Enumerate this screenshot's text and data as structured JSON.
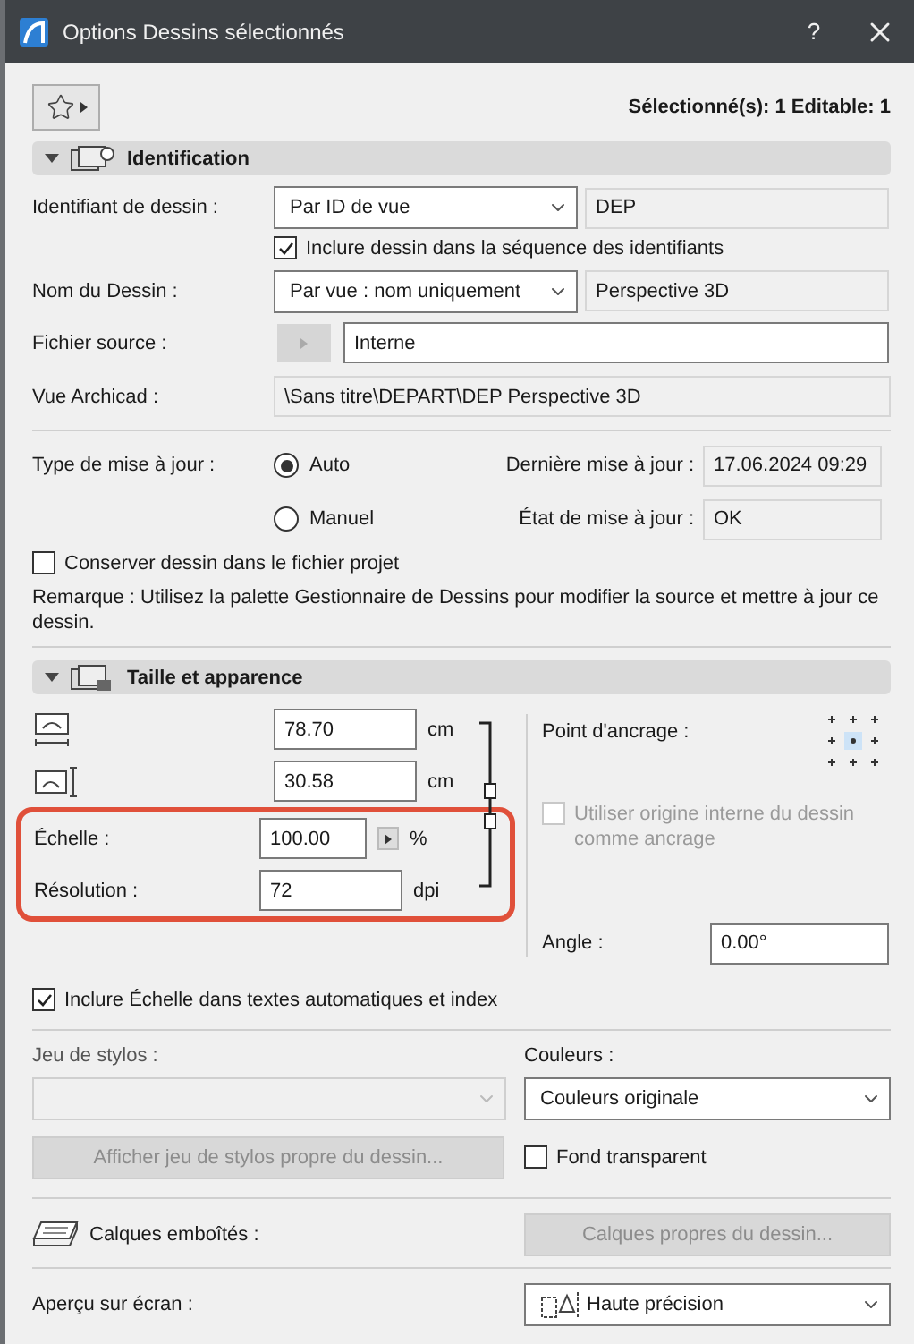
{
  "window": {
    "title": "Options Dessins sélectionnés",
    "help": "?"
  },
  "selection_summary": "Sélectionné(s): 1 Editable: 1",
  "identification": {
    "title": "Identification",
    "expanded": true,
    "drawing_id": {
      "label": "Identifiant de dessin :",
      "value": "Par ID de vue",
      "id": "DEP"
    },
    "include_in_sequence": {
      "label": "Inclure dessin dans la séquence des identifiants",
      "checked": true
    },
    "drawing_name": {
      "label": "Nom du Dessin :",
      "value": "Par vue : nom uniquement",
      "name": "Perspective 3D"
    },
    "source_file": {
      "label": "Fichier source :",
      "value": "Interne"
    },
    "archicad_view": {
      "label": "Vue Archicad :",
      "value": "\\Sans titre\\DEPART\\DEP Perspective 3D"
    },
    "update_type": {
      "label": "Type de mise à jour :",
      "options": [
        {
          "label": "Auto",
          "selected": true
        },
        {
          "label": "Manuel",
          "selected": false
        }
      ]
    },
    "last_update": {
      "label": "Dernière mise à jour :",
      "value": "17.06.2024 09:29"
    },
    "update_state": {
      "label": "État de mise à jour :",
      "value": "OK"
    },
    "keep_in_project": {
      "label": "Conserver dessin dans le fichier projet",
      "checked": false
    },
    "note": "Remarque : Utilisez la palette Gestionnaire de Dessins pour modifier la source et mettre à jour ce dessin."
  },
  "size": {
    "title": "Taille et apparence",
    "expanded": true,
    "width": {
      "value": "78.70",
      "unit": "cm"
    },
    "height": {
      "value": "30.58",
      "unit": "cm"
    },
    "scale": {
      "label": "Échelle :",
      "value": "100.00",
      "unit": "%"
    },
    "resolution": {
      "label": "Résolution :",
      "value": "72",
      "unit": "dpi"
    },
    "anchor": {
      "label": "Point d'ancrage :"
    },
    "use_internal_origin": {
      "label": "Utiliser origine interne du dessin comme ancrage",
      "checked": false,
      "disabled": true
    },
    "angle": {
      "label": "Angle :",
      "value": "0.00°"
    },
    "include_scale": {
      "label": "Inclure Échelle dans textes automatiques et index",
      "checked": true
    },
    "pen_set": {
      "label": "Jeu de stylos :",
      "disabled": true,
      "button": {
        "label": "Afficher jeu de stylos propre du dessin...",
        "disabled": true
      }
    },
    "colors": {
      "label": "Couleurs :",
      "value": "Couleurs originale"
    },
    "transparent": {
      "label": "Fond transparent",
      "checked": false
    },
    "layers": {
      "label": "Calques emboîtés :",
      "button": {
        "label": "Calques propres du dessin...",
        "disabled": true
      }
    },
    "preview": {
      "label": "Aperçu sur écran :",
      "value": "Haute précision"
    }
  }
}
